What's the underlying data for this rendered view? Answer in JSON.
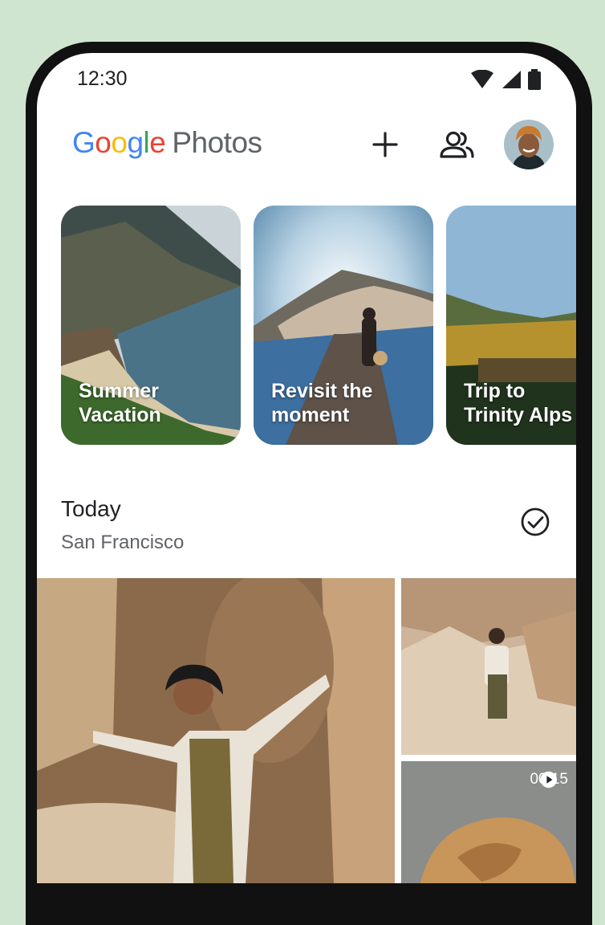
{
  "status_bar": {
    "time": "12:30",
    "icons": [
      "wifi-icon",
      "signal-icon",
      "battery-icon"
    ]
  },
  "app_bar": {
    "logo_letters": [
      "G",
      "o",
      "o",
      "g",
      "l",
      "e"
    ],
    "logo_product": "Photos",
    "actions": [
      "add-icon",
      "shared-people-icon",
      "account-avatar"
    ]
  },
  "memories": [
    {
      "title": "Summer\nVacation"
    },
    {
      "title": "Revisit the\nmoment"
    },
    {
      "title": "Trip to\nTrinity Alps"
    }
  ],
  "section": {
    "title": "Today",
    "location": "San Francisco",
    "select_icon": "check-circle-icon"
  },
  "grid": {
    "video_duration": "00:15",
    "video_icon": "play-icon"
  },
  "colors": {
    "background": "#cfe5cf",
    "google_blue": "#4285f4",
    "google_red": "#ea4335",
    "google_yellow": "#fbbc05",
    "google_green": "#34a853"
  }
}
